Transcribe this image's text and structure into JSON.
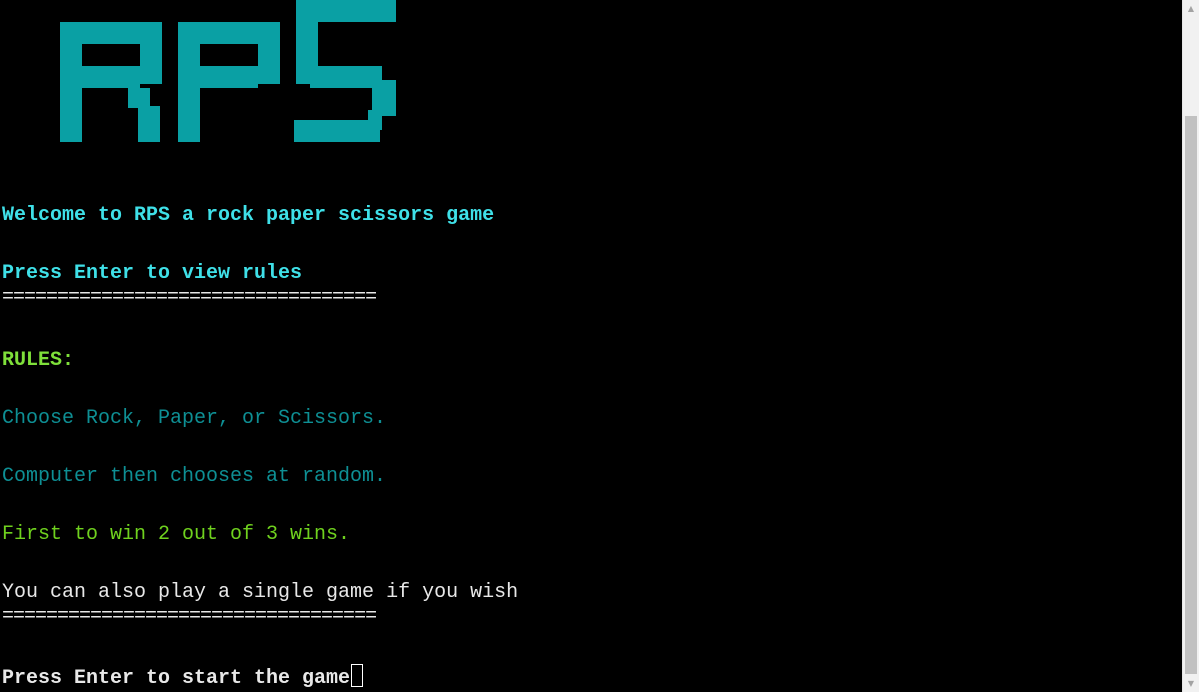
{
  "logo": {
    "text": "RPS",
    "color": "#0aa0a4"
  },
  "terminal": {
    "welcome": "Welcome to RPS a rock paper scissors game",
    "press_rules": "Press Enter to view rules",
    "divider1": "==================================",
    "rules_heading": "RULES:",
    "rule1": "Choose Rock, Paper, or Scissors.",
    "rule2": "Computer then chooses at random.",
    "rule3": "First to win 2 out of 3 wins.",
    "rule4": "You can also play a single game if you wish",
    "divider2": "==================================",
    "press_start": "Press Enter to start the game"
  },
  "colors": {
    "background": "#000000",
    "cyan": "#3fe0e8",
    "green": "#7fe03a",
    "teal": "#0e8f94",
    "green_plain": "#6fd11e",
    "white": "#e8e8e8"
  },
  "scrollbar": {
    "up_icon": "triangle-up-icon",
    "down_icon": "triangle-down-icon"
  }
}
